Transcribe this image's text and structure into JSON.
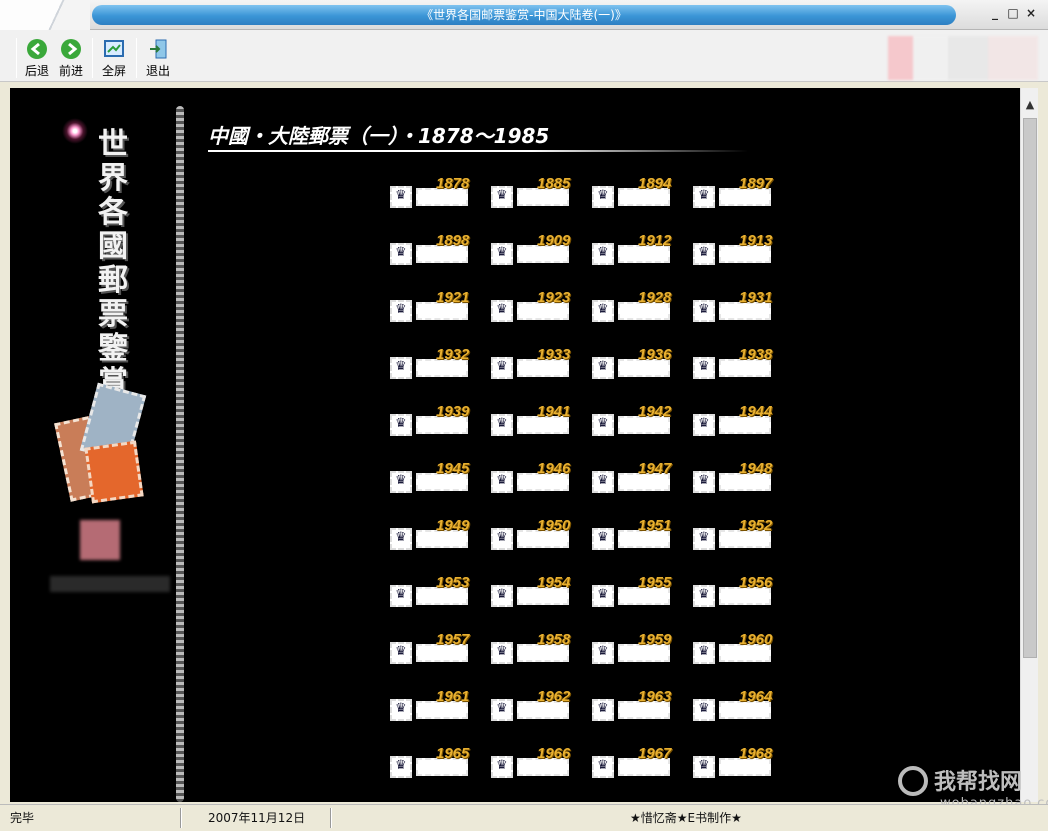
{
  "window": {
    "title": "《世界各国邮票鉴赏-中国大陆卷(一)》",
    "btn_min": "_",
    "btn_max": "□",
    "btn_close": "×"
  },
  "toolbar": {
    "back": "后退",
    "forward": "前进",
    "fullscreen": "全屏",
    "exit": "退出"
  },
  "sidebar": {
    "vertical_title": "世界各國郵票鑒賞"
  },
  "main": {
    "heading": "中國・大陸郵票（一）・1878～1985",
    "years": [
      [
        "1878",
        "1885",
        "1894",
        "1897"
      ],
      [
        "1898",
        "1909",
        "1912",
        "1913"
      ],
      [
        "1921",
        "1923",
        "1928",
        "1931"
      ],
      [
        "1932",
        "1933",
        "1936",
        "1938"
      ],
      [
        "1939",
        "1941",
        "1942",
        "1944"
      ],
      [
        "1945",
        "1946",
        "1947",
        "1948"
      ],
      [
        "1949",
        "1950",
        "1951",
        "1952"
      ],
      [
        "1953",
        "1954",
        "1955",
        "1956"
      ],
      [
        "1957",
        "1958",
        "1959",
        "1960"
      ],
      [
        "1961",
        "1962",
        "1963",
        "1964"
      ],
      [
        "1965",
        "1966",
        "1967",
        "1968"
      ]
    ]
  },
  "statusbar": {
    "status": "完毕",
    "date": "2007年11月12日",
    "credit": "★惜忆斋★E书制作★"
  },
  "watermark": {
    "cn": "我帮找网",
    "en": "wobangzhao.com"
  },
  "colors": {
    "title_bar": "#3b95d6",
    "year_text": "#e8b030",
    "content_bg": "#000000"
  }
}
